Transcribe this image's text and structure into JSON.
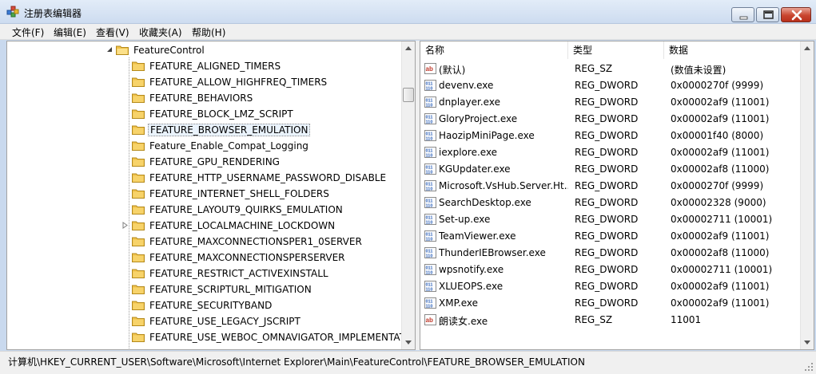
{
  "window": {
    "title": "注册表编辑器",
    "icons": {
      "app": "registry-editor-icon",
      "minimize": "minimize-icon",
      "maximize": "maximize-icon",
      "close": "close-icon"
    },
    "colors": {
      "titlebar": "#dbe6f4",
      "close_button": "#c9452f",
      "selection": "#eaf3fc",
      "folder": "#f1c24a"
    }
  },
  "menu": [
    "文件(F)",
    "编辑(E)",
    "查看(V)",
    "收藏夹(A)",
    "帮助(H)"
  ],
  "tree": {
    "parent": "FeatureControl",
    "items": [
      "FEATURE_ALIGNED_TIMERS",
      "FEATURE_ALLOW_HIGHFREQ_TIMERS",
      "FEATURE_BEHAVIORS",
      "FEATURE_BLOCK_LMZ_SCRIPT",
      "FEATURE_BROWSER_EMULATION",
      "Feature_Enable_Compat_Logging",
      "FEATURE_GPU_RENDERING",
      "FEATURE_HTTP_USERNAME_PASSWORD_DISABLE",
      "FEATURE_INTERNET_SHELL_FOLDERS",
      "FEATURE_LAYOUT9_QUIRKS_EMULATION",
      "FEATURE_LOCALMACHINE_LOCKDOWN",
      "FEATURE_MAXCONNECTIONSPER1_0SERVER",
      "FEATURE_MAXCONNECTIONSPERSERVER",
      "FEATURE_RESTRICT_ACTIVEXINSTALL",
      "FEATURE_SCRIPTURL_MITIGATION",
      "FEATURE_SECURITYBAND",
      "FEATURE_USE_LEGACY_JSCRIPT",
      "FEATURE_USE_WEBOC_OMNAVIGATOR_IMPLEMENTATION"
    ],
    "selected": "FEATURE_BROWSER_EMULATION",
    "expandable": "FEATURE_LOCALMACHINE_LOCKDOWN"
  },
  "list": {
    "columns": [
      "名称",
      "类型",
      "数据"
    ],
    "rows": [
      {
        "name": "(默认)",
        "type": "REG_SZ",
        "data": "(数值未设置)",
        "icon": "string-value-icon"
      },
      {
        "name": "devenv.exe",
        "type": "REG_DWORD",
        "data": "0x0000270f (9999)",
        "icon": "binary-value-icon"
      },
      {
        "name": "dnplayer.exe",
        "type": "REG_DWORD",
        "data": "0x00002af9 (11001)",
        "icon": "binary-value-icon"
      },
      {
        "name": "GloryProject.exe",
        "type": "REG_DWORD",
        "data": "0x00002af9 (11001)",
        "icon": "binary-value-icon"
      },
      {
        "name": "HaozipMiniPage.exe",
        "type": "REG_DWORD",
        "data": "0x00001f40 (8000)",
        "icon": "binary-value-icon"
      },
      {
        "name": "iexplore.exe",
        "type": "REG_DWORD",
        "data": "0x00002af9 (11001)",
        "icon": "binary-value-icon"
      },
      {
        "name": "KGUpdater.exe",
        "type": "REG_DWORD",
        "data": "0x00002af8 (11000)",
        "icon": "binary-value-icon"
      },
      {
        "name": "Microsoft.VsHub.Server.Ht...",
        "type": "REG_DWORD",
        "data": "0x0000270f (9999)",
        "icon": "binary-value-icon"
      },
      {
        "name": "SearchDesktop.exe",
        "type": "REG_DWORD",
        "data": "0x00002328 (9000)",
        "icon": "binary-value-icon"
      },
      {
        "name": "Set-up.exe",
        "type": "REG_DWORD",
        "data": "0x00002711 (10001)",
        "icon": "binary-value-icon"
      },
      {
        "name": "TeamViewer.exe",
        "type": "REG_DWORD",
        "data": "0x00002af9 (11001)",
        "icon": "binary-value-icon"
      },
      {
        "name": "ThunderIEBrowser.exe",
        "type": "REG_DWORD",
        "data": "0x00002af8 (11000)",
        "icon": "binary-value-icon"
      },
      {
        "name": "wpsnotify.exe",
        "type": "REG_DWORD",
        "data": "0x00002711 (10001)",
        "icon": "binary-value-icon"
      },
      {
        "name": "XLUEOPS.exe",
        "type": "REG_DWORD",
        "data": "0x00002af9 (11001)",
        "icon": "binary-value-icon"
      },
      {
        "name": "XMP.exe",
        "type": "REG_DWORD",
        "data": "0x00002af9 (11001)",
        "icon": "binary-value-icon"
      },
      {
        "name": "朗读女.exe",
        "type": "REG_SZ",
        "data": "11001",
        "icon": "string-value-icon"
      }
    ]
  },
  "status": "计算机\\HKEY_CURRENT_USER\\Software\\Microsoft\\Internet Explorer\\Main\\FeatureControl\\FEATURE_BROWSER_EMULATION"
}
